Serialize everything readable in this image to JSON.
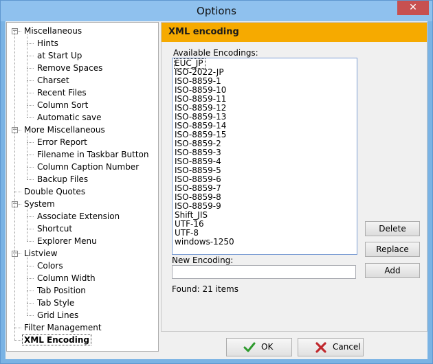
{
  "window": {
    "title": "Options",
    "close_glyph": "✕"
  },
  "tree": {
    "items": [
      {
        "label": "Miscellaneous",
        "level": 0,
        "expander": "-"
      },
      {
        "label": "Hints",
        "level": 1
      },
      {
        "label": "at Start Up",
        "level": 1
      },
      {
        "label": "Remove Spaces",
        "level": 1
      },
      {
        "label": "Charset",
        "level": 1
      },
      {
        "label": "Recent Files",
        "level": 1
      },
      {
        "label": "Column Sort",
        "level": 1
      },
      {
        "label": "Automatic save",
        "level": 1
      },
      {
        "label": "More Miscellaneous",
        "level": 0,
        "expander": "-"
      },
      {
        "label": "Error Report",
        "level": 1
      },
      {
        "label": "Filename in Taskbar Button",
        "level": 1
      },
      {
        "label": "Column Caption Number",
        "level": 1
      },
      {
        "label": "Backup Files",
        "level": 1
      },
      {
        "label": "Double Quotes",
        "level": 0
      },
      {
        "label": "System",
        "level": 0,
        "expander": "-"
      },
      {
        "label": "Associate Extension",
        "level": 1
      },
      {
        "label": "Shortcut",
        "level": 1
      },
      {
        "label": "Explorer Menu",
        "level": 1
      },
      {
        "label": "Listview",
        "level": 0,
        "expander": "-"
      },
      {
        "label": "Colors",
        "level": 1
      },
      {
        "label": "Column Width",
        "level": 1
      },
      {
        "label": "Tab Position",
        "level": 1
      },
      {
        "label": "Tab Style",
        "level": 1
      },
      {
        "label": "Grid Lines",
        "level": 1
      },
      {
        "label": "Filter Management",
        "level": 0
      },
      {
        "label": "XML Encoding",
        "level": 0,
        "selected": true
      }
    ]
  },
  "panel": {
    "header": "XML encoding",
    "available_label": "Available Encodings:",
    "encodings": [
      "EUC_JP",
      "ISO-2022-JP",
      "ISO-8859-1",
      "ISO-8859-10",
      "ISO-8859-11",
      "ISO-8859-12",
      "ISO-8859-13",
      "ISO-8859-14",
      "ISO-8859-15",
      "ISO-8859-2",
      "ISO-8859-3",
      "ISO-8859-4",
      "ISO-8859-5",
      "ISO-8859-6",
      "ISO-8859-7",
      "ISO-8859-8",
      "ISO-8859-9",
      "Shift_JIS",
      "UTF-16",
      "UTF-8",
      "windows-1250"
    ],
    "focused_encoding": "EUC_JP",
    "delete_label": "Delete",
    "replace_label": "Replace",
    "add_label": "Add",
    "new_label": "New Encoding:",
    "new_value": "",
    "found_text": "Found: 21 items"
  },
  "footer": {
    "ok_label": "OK",
    "cancel_label": "Cancel"
  },
  "colors": {
    "header": "#f6aa00",
    "ok_icon": "#2d9a2d",
    "cancel_icon": "#c0282d",
    "titlebar": "#8fc1ee"
  },
  "icons": {
    "ok": "checkmark-icon",
    "cancel": "x-mark-icon"
  }
}
